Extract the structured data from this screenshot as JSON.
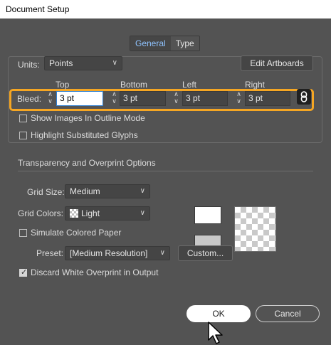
{
  "window": {
    "title": "Document Setup"
  },
  "tabs": [
    {
      "label": "General",
      "active": true
    },
    {
      "label": "Type",
      "active": false
    }
  ],
  "units": {
    "label": "Units:",
    "value": "Points"
  },
  "edit_artboards_label": "Edit Artboards",
  "bleed": {
    "label": "Bleed:",
    "top": {
      "label": "Top",
      "value": "3 pt"
    },
    "bottom": {
      "label": "Bottom",
      "value": "3 pt"
    },
    "left": {
      "label": "Left",
      "value": "3 pt"
    },
    "right": {
      "label": "Right",
      "value": "3 pt"
    },
    "link_icon": "chain-link-icon",
    "highlight_color": "#f5a623"
  },
  "options": {
    "show_images_outline": {
      "label": "Show Images In Outline Mode",
      "checked": false
    },
    "highlight_glyphs": {
      "label": "Highlight Substituted Glyphs",
      "checked": false
    }
  },
  "transparency": {
    "section_title": "Transparency and Overprint Options",
    "grid_size": {
      "label": "Grid Size:",
      "value": "Medium"
    },
    "grid_colors": {
      "label": "Grid Colors:",
      "value": "Light"
    },
    "simulate_paper": {
      "label": "Simulate Colored Paper",
      "checked": false
    },
    "preset": {
      "label": "Preset:",
      "value": "[Medium Resolution]"
    },
    "custom_label": "Custom...",
    "discard_white": {
      "label": "Discard White Overprint in Output",
      "checked": true
    }
  },
  "footer": {
    "ok_label": "OK",
    "cancel_label": "Cancel"
  },
  "colors": {
    "accent_tab": "#8fc3ff",
    "background": "#535353"
  }
}
